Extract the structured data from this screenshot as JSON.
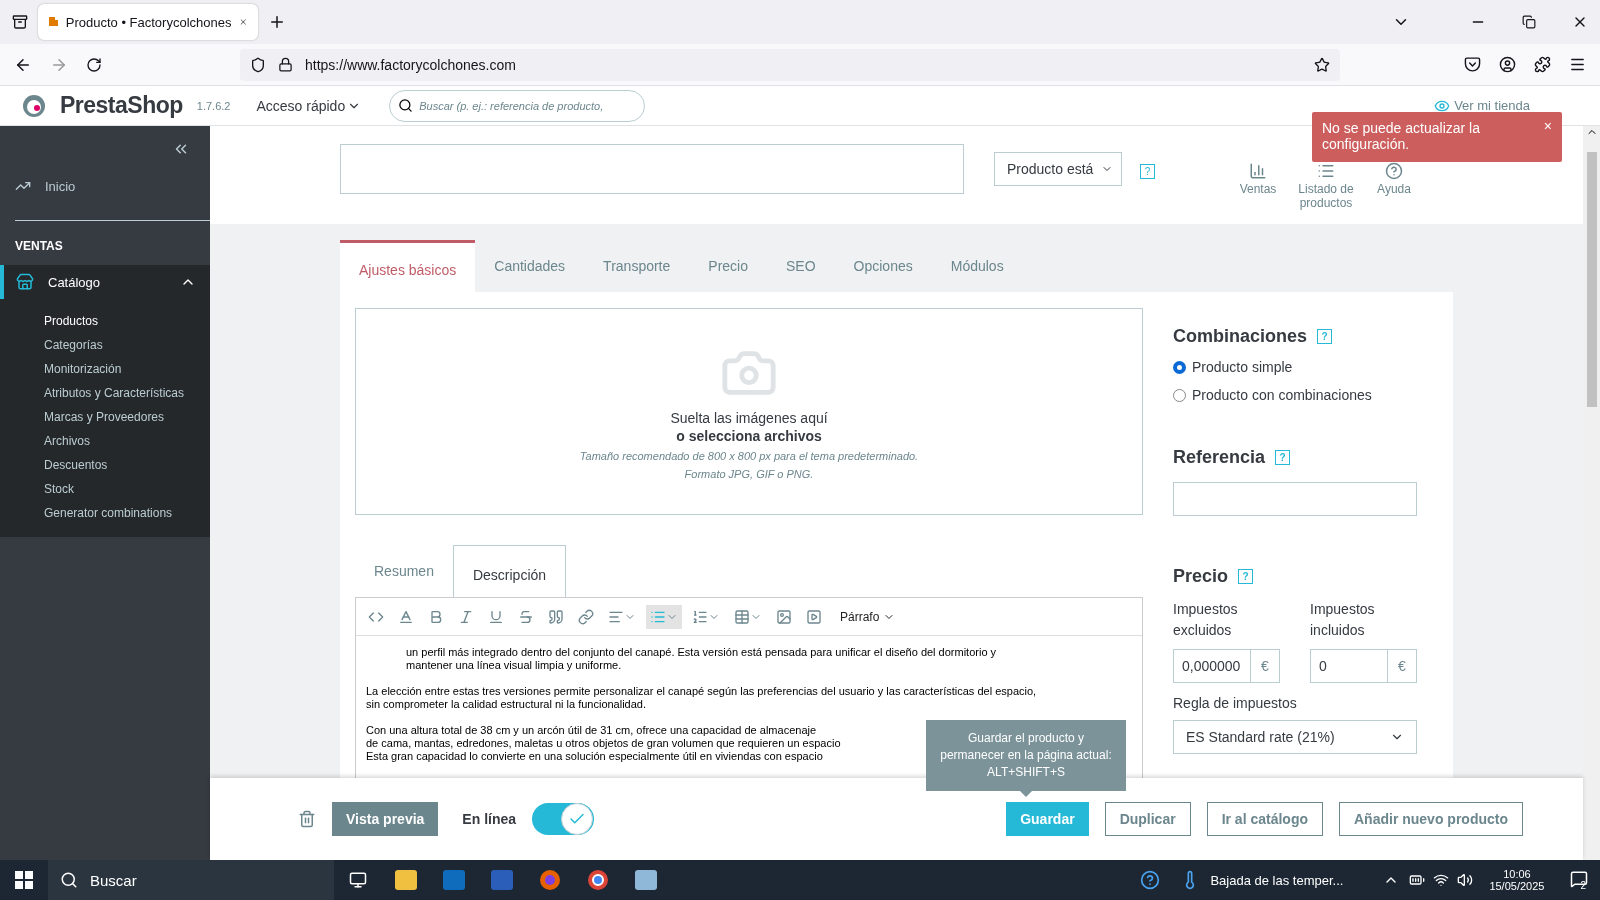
{
  "browser": {
    "tab_title": "Producto • Factorycolchones",
    "url": "https://www.factorycolchones.com"
  },
  "header": {
    "brand": "PrestaShop",
    "version": "1.7.6.2",
    "quick_access": "Acceso rápido",
    "search_placeholder": "Buscar (p. ej.: referencia de producto,",
    "store_link": "Ver mi tienda"
  },
  "notification": {
    "text": "No se puede actualizar la configuración.",
    "close": "×"
  },
  "sidebar": {
    "items": [
      {
        "kind": "link",
        "label": "Inicio",
        "selected": false
      },
      {
        "kind": "section",
        "label": "VENTAS"
      },
      {
        "kind": "group",
        "label": "Catálogo",
        "selected": true,
        "expanded": true,
        "children": [
          {
            "label": "Productos",
            "selected": true
          },
          {
            "label": "Categorías",
            "selected": false
          },
          {
            "label": "Monitorización",
            "selected": false
          },
          {
            "label": "Atributos y Características",
            "selected": false
          },
          {
            "label": "Marcas y Proveedores",
            "selected": false
          },
          {
            "label": "Archivos",
            "selected": false
          },
          {
            "label": "Descuentos",
            "selected": false
          },
          {
            "label": "Stock",
            "selected": false
          },
          {
            "label": "Generator combinations",
            "selected": false
          }
        ]
      }
    ]
  },
  "product": {
    "type_select": "Producto está",
    "help": "?",
    "actions": [
      {
        "kind": "chart",
        "label": "Ventas"
      },
      {
        "kind": "list",
        "label": "Listado de productos"
      },
      {
        "kind": "help",
        "label": "Ayuda"
      }
    ]
  },
  "tabs": [
    {
      "label": "Ajustes básicos",
      "selected": true
    },
    {
      "label": "Cantidades",
      "selected": false
    },
    {
      "label": "Transporte",
      "selected": false
    },
    {
      "label": "Precio",
      "selected": false
    },
    {
      "label": "SEO",
      "selected": false
    },
    {
      "label": "Opciones",
      "selected": false
    },
    {
      "label": "Módulos",
      "selected": false
    }
  ],
  "dropzone": {
    "title": "Suelta las imágenes aquí",
    "link": "o selecciona archivos",
    "hints": [
      "Tamaño recomendado de 800 x 800 px para el tema predeterminado.",
      "Formato JPG, GIF o PNG."
    ]
  },
  "description": {
    "tabs": [
      {
        "label": "Resumen",
        "selected": false
      },
      {
        "label": "Descripción",
        "selected": true
      }
    ],
    "toolbar": {
      "format": "Párrafo",
      "bullet_list_active": true
    },
    "paragraphs": [
      {
        "kind": "bullet",
        "lines": [
          "un perfil más integrado dentro del conjunto del canapé. Esta versión está pensada para unificar el diseño del dormitorio y",
          "mantener una línea visual limpia y uniforme."
        ]
      },
      {
        "kind": "text",
        "lines": [
          "La elección entre estas tres versiones permite personalizar el canapé según las preferencias del usuario y las características del espacio,",
          "sin comprometer la calidad estructural ni la funcionalidad."
        ]
      },
      {
        "kind": "text",
        "lines": [
          "Con una altura total de 38 cm y un arcón útil de 31 cm, ofrece una capacidad de almacenaje",
          "de cama, mantas, edredones, maletas u otros objetos de gran volumen que requieren un espacio",
          "Esta gran capacidad lo convierte en una solución especialmente útil en viviendas con espacio"
        ]
      }
    ]
  },
  "combinations": {
    "title": "Combinaciones",
    "help": "?",
    "options": [
      {
        "label": "Producto simple",
        "selected": true
      },
      {
        "label": "Producto con combinaciones",
        "selected": false
      }
    ]
  },
  "reference": {
    "title": "Referencia",
    "help": "?"
  },
  "price": {
    "title": "Precio",
    "help": "?",
    "fields": [
      {
        "label": "Impuestos excluidos",
        "value": "0,000000",
        "unit": "€"
      },
      {
        "label": "Impuestos incluidos",
        "value": "0",
        "unit": "€"
      }
    ],
    "tax_label": "Regla de impuestos",
    "tax_rule": "ES Standard rate (21%)"
  },
  "footer": {
    "preview": "Vista previa",
    "online_label": "En línea",
    "online": true,
    "buttons": [
      {
        "kind": "primary",
        "label": "Guardar"
      },
      {
        "kind": "outline",
        "label": "Duplicar"
      },
      {
        "kind": "outline",
        "label": "Ir al catálogo"
      },
      {
        "kind": "outline",
        "label": "Añadir nuevo producto"
      }
    ],
    "tooltip": "Guardar el producto y permanecer en la página actual: ALT+SHIFT+S"
  },
  "taskbar": {
    "search": "Buscar",
    "weather": "Bajada de las temper...",
    "time": "10:06",
    "date": "15/05/2025",
    "notifications": "2"
  }
}
